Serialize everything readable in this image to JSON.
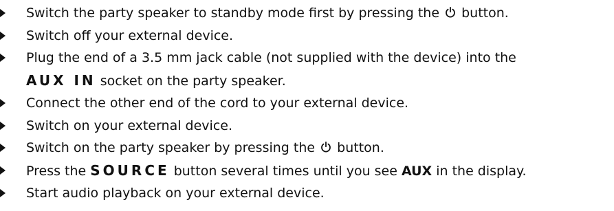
{
  "steps": [
    {
      "parts": {
        "before": "Switch the party speaker to standby mode first by pressing the ",
        "after": " button."
      }
    },
    {
      "text": "Switch off your external device."
    },
    {
      "line1": "Plug the end of a 3.5 mm jack cable (not supplied with the device) into the",
      "keyword": "AUX IN",
      "line2_after": " socket on the party speaker."
    },
    {
      "text": "Connect the other end of the cord to your external device."
    },
    {
      "text": "Switch on your external device."
    },
    {
      "parts": {
        "before": "Switch on the party speaker by pressing the ",
        "after": " button."
      }
    },
    {
      "before": "Press the ",
      "keyword": "SOURCE",
      "middle": " button several times until you see ",
      "keyword2": "AUX",
      "after": " in the display."
    },
    {
      "text": "Start audio playback on your external device."
    }
  ],
  "icons": {
    "bullet": "triangle-bullet-icon",
    "power": "power-icon"
  }
}
